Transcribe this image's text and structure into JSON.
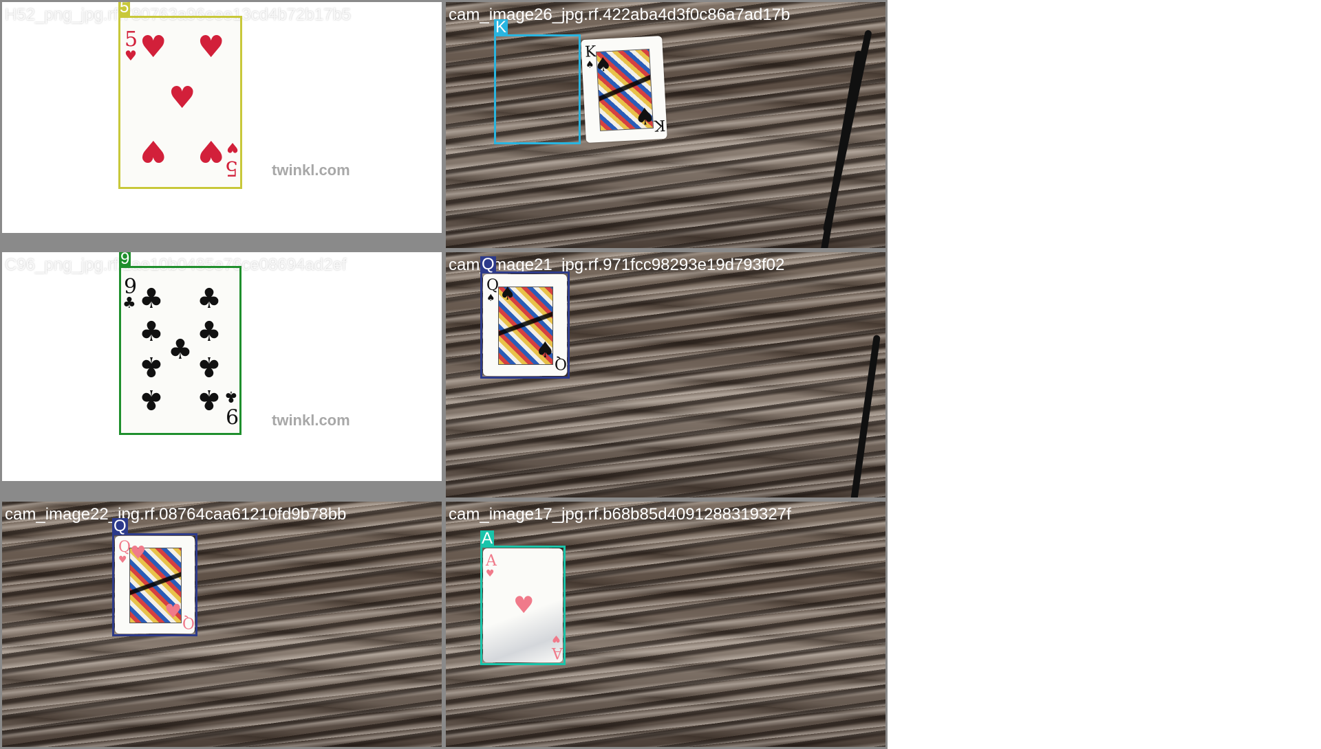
{
  "tiles": [
    {
      "caption": "H52_png_jpg.rf.780763a96eee13cd4b72b17b5",
      "label": "5",
      "box_color": "#c8c83a",
      "watermark": "twinkl.com",
      "card_rank": "5",
      "card_suit": "♥"
    },
    {
      "caption": "cam_image26_jpg.rf.422aba4d3f0c86a7ad17b",
      "label": "K",
      "box_color": "#29b5e0",
      "card_rank": "K",
      "card_suit": "♠"
    },
    {
      "caption": "C96_png_jpg.rf.1ae10b0485e76ce08694ad2ef",
      "label": "9",
      "box_color": "#1f8f2d",
      "watermark": "twinkl.com",
      "card_rank": "9",
      "card_suit": "♣"
    },
    {
      "caption": "cam_image21_jpg.rf.971fcc98293e19d793f02",
      "label": "Q",
      "box_color": "#2c3a8a",
      "card_rank": "Q",
      "card_suit": "♠"
    },
    {
      "caption": "cam_image22_jpg.rf.08764caa61210fd9b78bb",
      "label": "Q",
      "box_color": "#2c3a8a",
      "card_rank": "Q",
      "card_suit": "♥"
    },
    {
      "caption": "cam_image17_jpg.rf.b68b85d4091288319327f",
      "label": "A",
      "box_color": "#19c4aa",
      "card_rank": "A",
      "card_suit": "♥"
    }
  ]
}
